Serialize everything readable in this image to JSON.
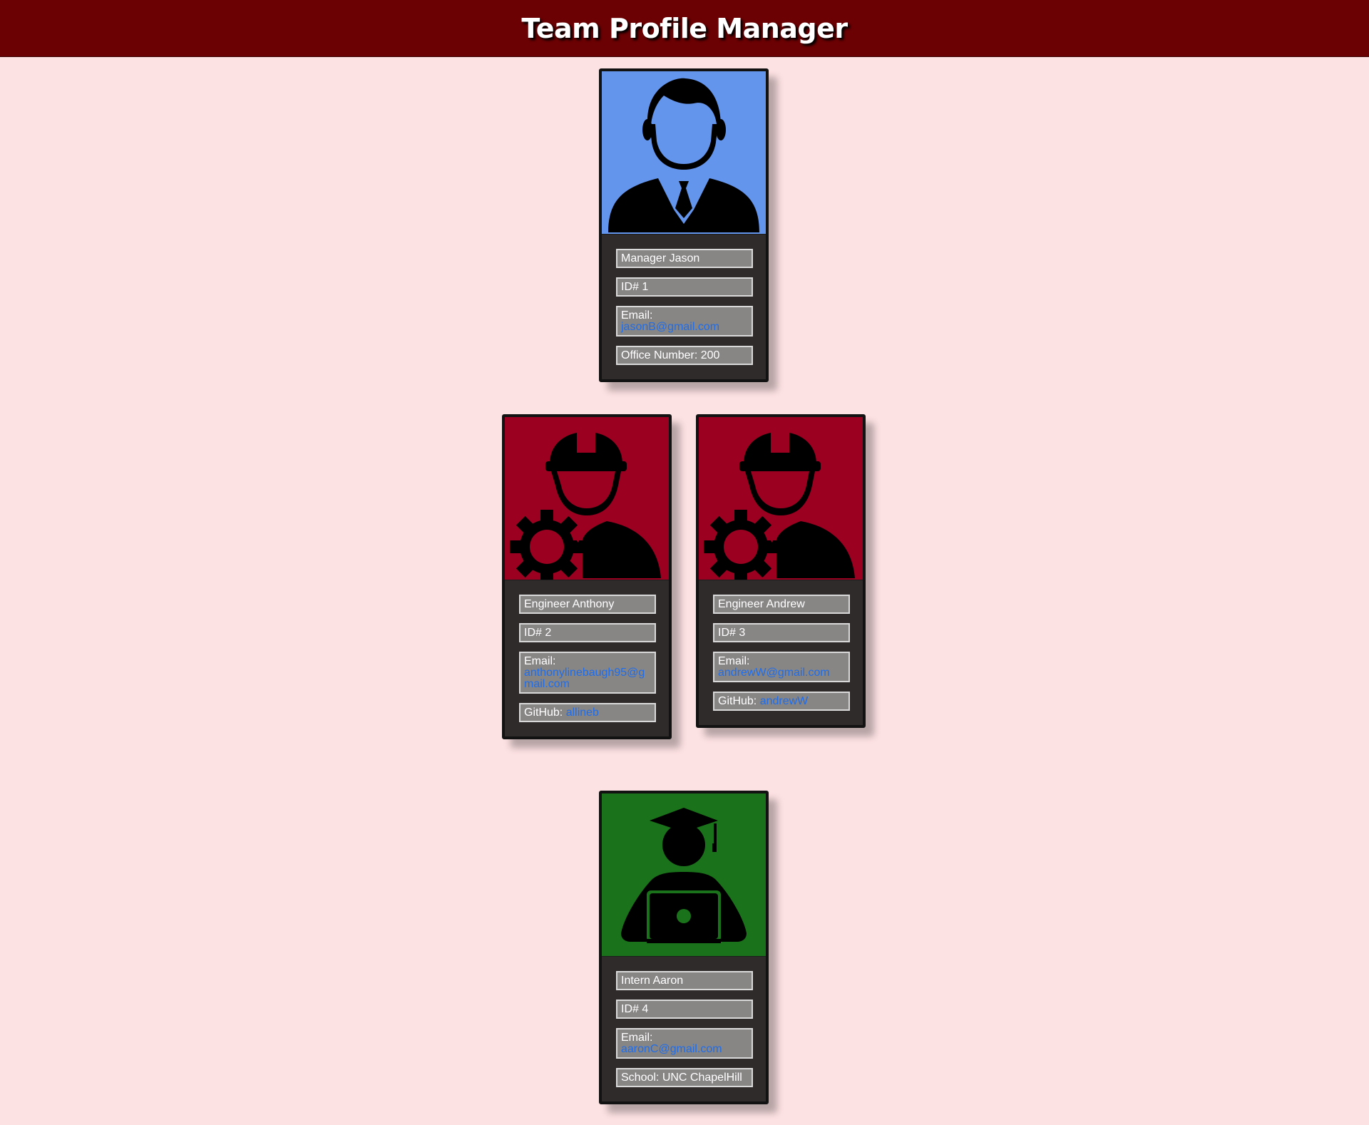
{
  "header": {
    "title": "Team Profile Manager"
  },
  "colors": {
    "banner": "#6b0103",
    "background": "#fde2e3",
    "manager": "#6495ed",
    "engineer": "#9b0020",
    "intern": "#1a731a",
    "card": "#2f2b2b",
    "field": "#888585",
    "link": "#1f6de8"
  },
  "cards": {
    "manager": {
      "icon": "manager-icon",
      "name": "Manager Jason",
      "id": "ID# 1",
      "email_label": "Email:",
      "email": "jasonB@gmail.com",
      "extra": "Office Number: 200"
    },
    "engineer1": {
      "icon": "engineer-icon",
      "name": "Engineer Anthony",
      "id": "ID# 2",
      "email_label": "Email:",
      "email": "anthonylinebaugh95@gmail.com",
      "extra_label": "GitHub:",
      "extra_link": "allineb"
    },
    "engineer2": {
      "icon": "engineer-icon",
      "name": "Engineer Andrew",
      "id": "ID# 3",
      "email_label": "Email:",
      "email": "andrewW@gmail.com",
      "extra_label": "GitHub:",
      "extra_link": "andrewW"
    },
    "intern": {
      "icon": "intern-icon",
      "name": "Intern Aaron",
      "id": "ID# 4",
      "email_label": "Email:",
      "email": "aaronC@gmail.com",
      "extra": "School: UNC ChapelHill"
    }
  }
}
